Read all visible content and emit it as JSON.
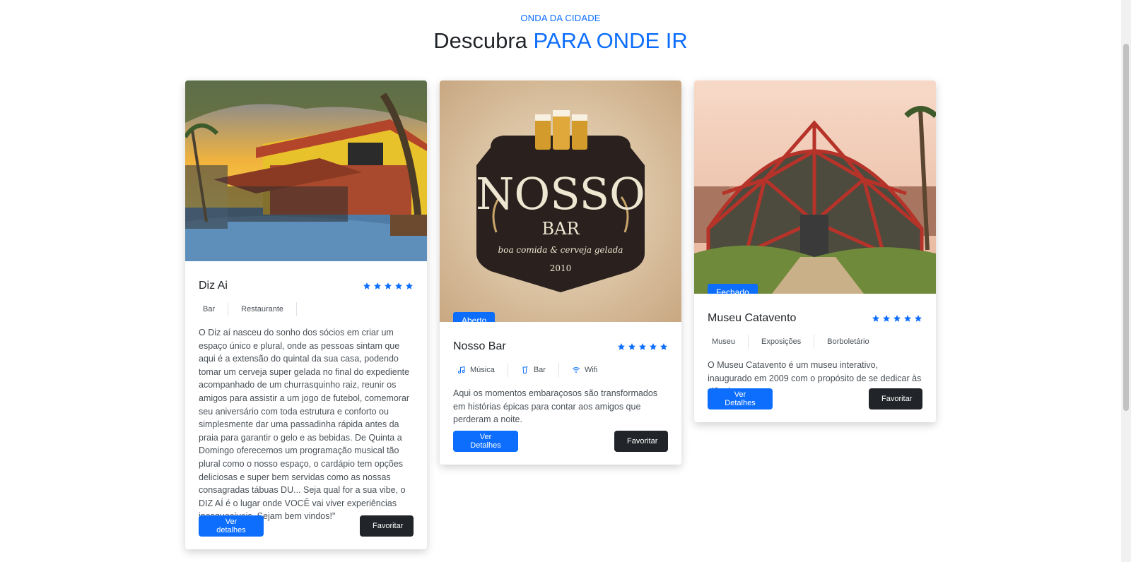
{
  "section": {
    "eyebrow": "ONDA DA CIDADE",
    "title_prefix": "Descubra",
    "title_accent": "PARA ONDE IR"
  },
  "cards": [
    {
      "title": "Diz Ai",
      "rating": 5,
      "status": "",
      "tags": [
        "Bar",
        "Restaurante"
      ],
      "description": "O Diz aí nasceu do sonho dos sócios em criar um espaço único e plural, onde as pessoas sintam que aqui é a extensão do quintal da sua casa, podendo tomar um cerveja super gelada no final do expediente acompanhado de um churrasquinho raiz, reunir os amigos para assistir a um jogo de futebol, comemorar seu aniversário com toda estrutura e conforto ou simplesmente dar uma passadinha rápida antes da praia para garantir o gelo e as bebidas. De Quinta a Domingo oferecemos um programação musical tão plural como o nosso espaço, o cardápio tem opções deliciosas e super bem servidas como as nossas consagradas tábuas DU... Seja qual for a sua vibe, o DIZ AÍ é o lugar onde VOCÊ vai viver experiências inesquecíveis. Sejam bem vindos!\"",
      "details_label": "Ver detalhes",
      "favorite_label": "Favoritar"
    },
    {
      "title": "Nosso Bar",
      "rating": 5,
      "status": "Aberto",
      "tags": [
        "Música",
        "Bar",
        "Wifi"
      ],
      "tag_icons": [
        "music-note-icon",
        "cup-icon",
        "wifi-icon"
      ],
      "description": "Aqui os momentos embaraçosos são transformados em histórias épicas para contar aos amigos que perderam a noite.",
      "details_label": "Ver Detalhes",
      "favorite_label": "Favoritar",
      "logo": {
        "name": "NOSSO",
        "sub": "BAR",
        "tagline": "boa comida & cerveja gelada",
        "year": "2010"
      }
    },
    {
      "title": "Museu Catavento",
      "rating": 5,
      "status": "Fechado",
      "tags": [
        "Museu",
        "Exposições",
        "Borboletário"
      ],
      "description": "O Museu Catavento é um museu interativo, inaugurado em 2009 com o propósito de se dedicar às ciências.",
      "details_label": "Ver Detalhes",
      "favorite_label": "Favoritar"
    }
  ],
  "colors": {
    "accent": "#0d6efd",
    "dark_button": "#212529",
    "text": "#212529",
    "muted": "#495057"
  }
}
